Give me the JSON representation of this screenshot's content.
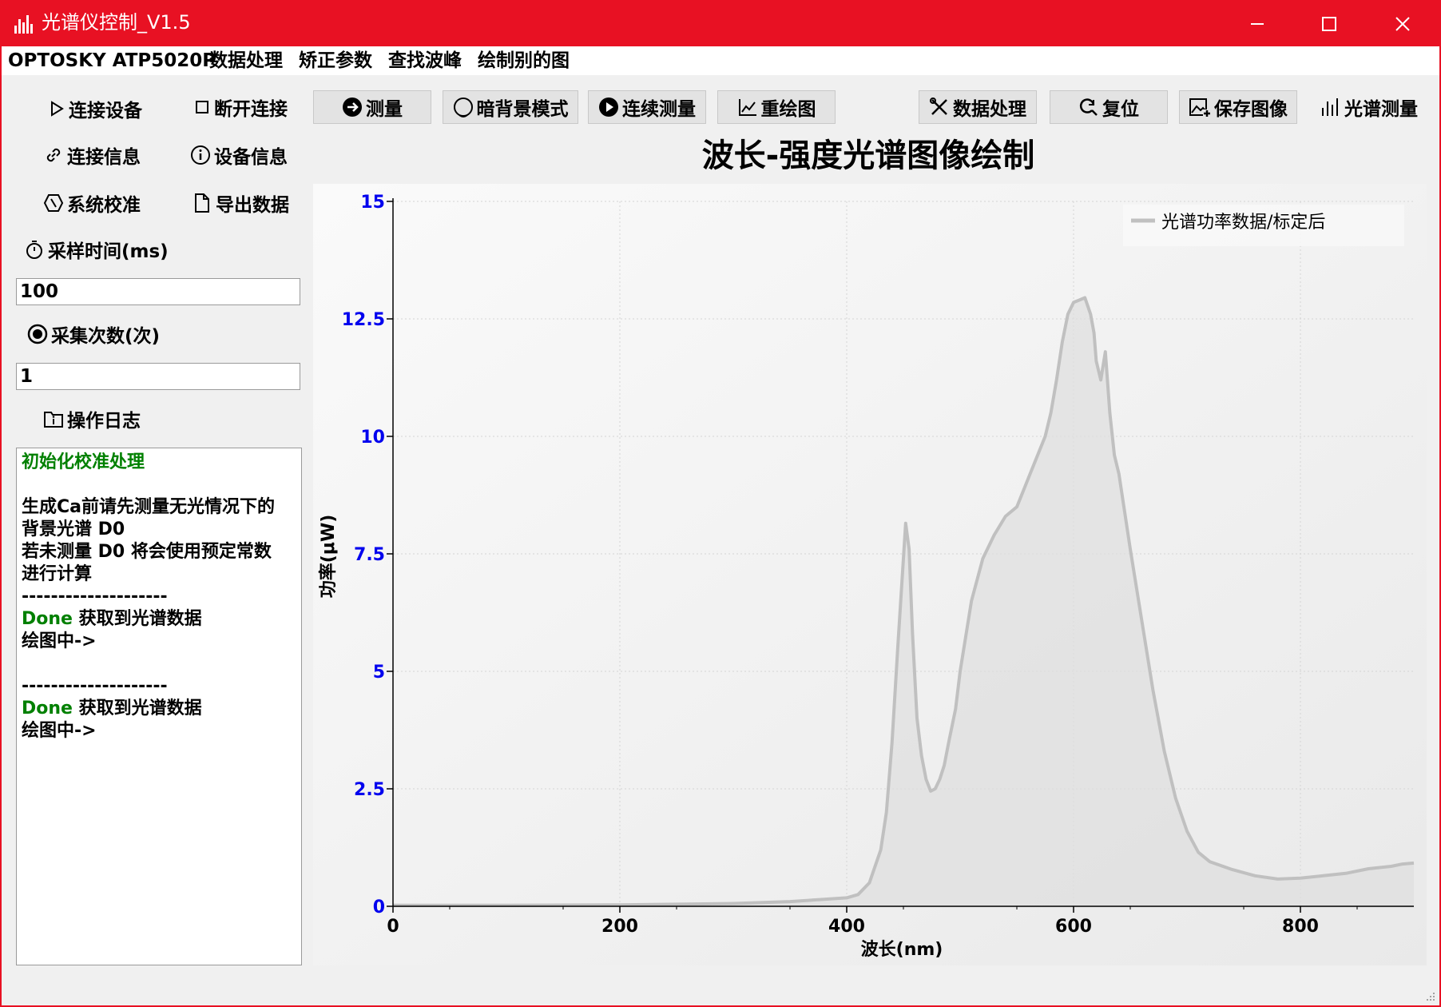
{
  "window": {
    "title": "光谱仪控制_V1.5"
  },
  "menu": [
    "OPTOSKY ATP5020P",
    "数据处理",
    "矫正参数",
    "查找波峰",
    "绘制别的图"
  ],
  "sidebar": {
    "connect": "连接设备",
    "disconnect": "断开连接",
    "conn_info": "连接信息",
    "device_info": "设备信息",
    "calibrate": "系统校准",
    "export": "导出数据",
    "sample_time_label": "采样时间(ms)",
    "sample_time_value": "100",
    "collect_count_label": "采集次数(次)",
    "collect_count_value": "1",
    "log_label": "操作日志"
  },
  "log": {
    "l1": "初始化校准处理",
    "l2": "生成Ca前请先测量无光情况下的",
    "l3": "背景光谱 D0",
    "l4": "若未测量 D0 将会使用预定常数",
    "l5": "进行计算",
    "sep": "--------------------",
    "done": "Done",
    "got": " 获取到光谱数据",
    "plotting": "绘图中->"
  },
  "toolbar": {
    "measure": "测量",
    "dark": "暗背景模式",
    "continuous": "连续测量",
    "redraw": "重绘图",
    "process": "数据处理",
    "reset": "复位",
    "save": "保存图像",
    "spectrum": "光谱测量"
  },
  "chart_data": {
    "type": "area",
    "title": "波长-强度光谱图像绘制",
    "xlabel": "波长(nm)",
    "ylabel": "功率(μW)",
    "xlim": [
      0,
      900
    ],
    "ylim": [
      0,
      15
    ],
    "xticks": [
      "0",
      "200",
      "400",
      "600",
      "800"
    ],
    "yticks": [
      "0",
      "2.5",
      "5",
      "7.5",
      "10",
      "12.5",
      "15"
    ],
    "legend": "top-right",
    "grid": true,
    "colors": {
      "line": "#c0c0c0",
      "fill": "#dedede",
      "ytick": "#0000ee"
    },
    "series": [
      {
        "name": "光谱功率数据/标定后",
        "x": [
          0,
          100,
          200,
          300,
          350,
          380,
          400,
          410,
          420,
          430,
          435,
          440,
          445,
          450,
          452,
          455,
          458,
          462,
          466,
          470,
          474,
          478,
          482,
          486,
          490,
          496,
          500,
          510,
          520,
          530,
          540,
          550,
          555,
          560,
          565,
          570,
          575,
          580,
          585,
          590,
          595,
          600,
          605,
          610,
          615,
          618,
          620,
          624,
          628,
          632,
          636,
          640,
          650,
          660,
          670,
          680,
          690,
          700,
          710,
          720,
          740,
          760,
          780,
          800,
          820,
          840,
          860,
          880,
          890,
          900
        ],
        "y": [
          0.02,
          0.02,
          0.03,
          0.06,
          0.1,
          0.15,
          0.18,
          0.25,
          0.5,
          1.2,
          2.0,
          3.5,
          5.5,
          7.4,
          8.15,
          7.6,
          5.8,
          4.0,
          3.2,
          2.7,
          2.45,
          2.5,
          2.7,
          3.0,
          3.5,
          4.2,
          5.0,
          6.5,
          7.4,
          7.9,
          8.3,
          8.5,
          8.8,
          9.1,
          9.4,
          9.7,
          10.0,
          10.5,
          11.2,
          12.0,
          12.6,
          12.85,
          12.9,
          12.95,
          12.6,
          12.2,
          11.6,
          11.2,
          11.8,
          10.5,
          9.6,
          9.2,
          7.6,
          6.1,
          4.6,
          3.3,
          2.3,
          1.6,
          1.15,
          0.95,
          0.78,
          0.65,
          0.58,
          0.6,
          0.65,
          0.7,
          0.8,
          0.85,
          0.9,
          0.92
        ]
      }
    ]
  }
}
